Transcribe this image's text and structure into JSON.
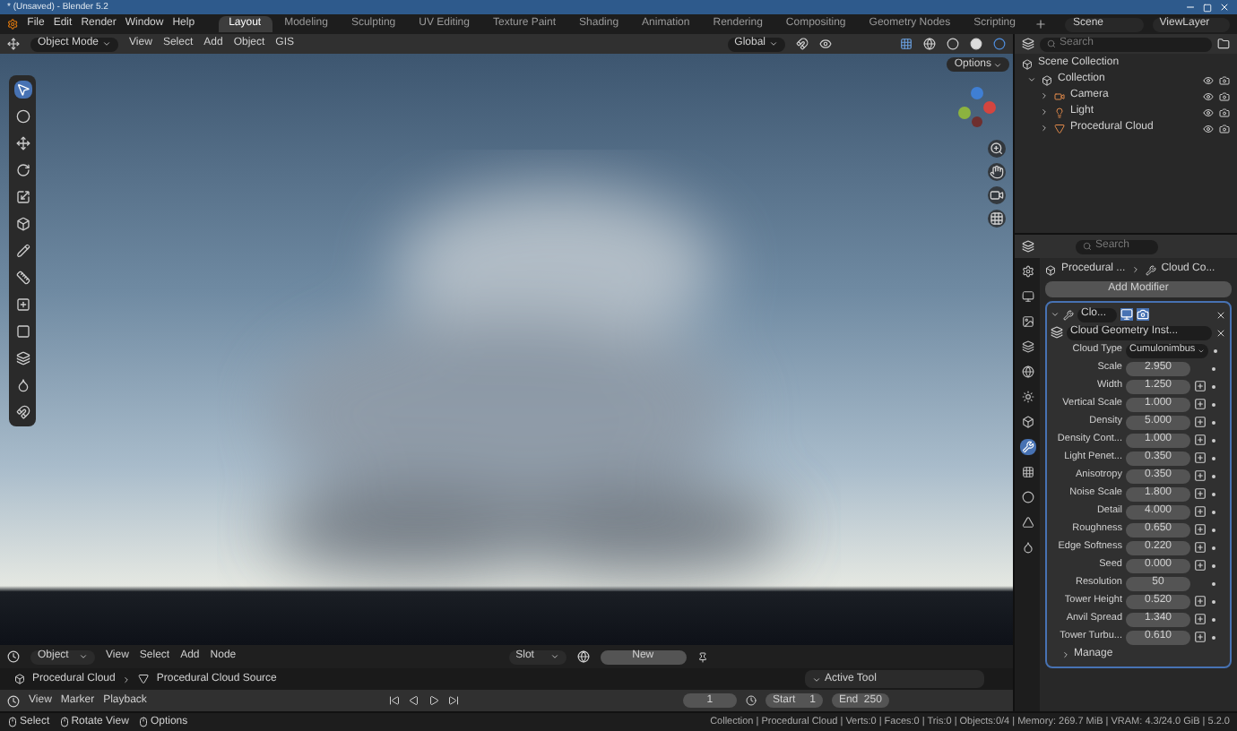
{
  "window": {
    "title": "* (Unsaved) - Blender 5.2"
  },
  "menu": [
    "File",
    "Edit",
    "Render",
    "Window",
    "Help"
  ],
  "workspaces": [
    {
      "label": "Layout",
      "selected": true
    },
    {
      "label": "Modeling",
      "selected": false
    },
    {
      "label": "Sculpting",
      "selected": false
    },
    {
      "label": "UV Editing",
      "selected": false
    },
    {
      "label": "Texture Paint",
      "selected": false
    },
    {
      "label": "Shading",
      "selected": false
    },
    {
      "label": "Animation",
      "selected": false
    },
    {
      "label": "Rendering",
      "selected": false
    },
    {
      "label": "Compositing",
      "selected": false
    },
    {
      "label": "Geometry Nodes",
      "selected": false
    },
    {
      "label": "Scripting",
      "selected": false
    }
  ],
  "scene": "Scene",
  "view_layer": "ViewLayer",
  "viewport_header": {
    "mode": "Object Mode",
    "menus": [
      "View",
      "Select",
      "Add",
      "Object",
      "GIS"
    ],
    "orientation": "Global"
  },
  "viewport": {
    "options": "Options",
    "tools": [
      {
        "selected": true
      },
      {
        "selected": false
      },
      {
        "selected": false
      },
      {
        "selected": false
      },
      {
        "selected": false
      },
      {
        "selected": false
      },
      {
        "selected": false
      },
      {
        "selected": false
      },
      {
        "selected": false
      },
      {
        "selected": false
      },
      {
        "selected": false
      },
      {
        "selected": false
      },
      {
        "selected": false
      }
    ]
  },
  "outliner": {
    "search_placeholder": "Search",
    "root": "Scene Collection",
    "collections": [
      {
        "label": "Collection",
        "expanded": true,
        "children": [
          {
            "label": "Camera",
            "kind": "camera",
            "expanded": false
          },
          {
            "label": "Light",
            "kind": "light",
            "expanded": false
          },
          {
            "label": "Procedural Cloud",
            "kind": "mesh",
            "expanded": false
          }
        ]
      }
    ]
  },
  "properties": {
    "search_placeholder": "Search",
    "tabs": [
      {
        "selected": false
      },
      {
        "selected": false
      },
      {
        "selected": false
      },
      {
        "selected": false
      },
      {
        "selected": false
      },
      {
        "selected": false
      },
      {
        "selected": false
      },
      {
        "selected": true
      },
      {
        "selected": false
      },
      {
        "selected": false
      },
      {
        "selected": false
      },
      {
        "selected": false
      }
    ],
    "breadcrumb": [
      "Procedural ...",
      "Cloud Co..."
    ],
    "add_modifier": "Add Modifier",
    "modifier": {
      "name": "Clo...",
      "expanded": true,
      "node_group": "Cloud Geometry Inst...",
      "rows": [
        {
          "label": "Cloud Type",
          "value": "Cumulonimbus",
          "kind": "dropdown"
        },
        {
          "label": "Scale",
          "value": "2.950",
          "kind": "plain"
        },
        {
          "label": "Width",
          "value": "1.250",
          "kind": "socket"
        },
        {
          "label": "Vertical Scale",
          "value": "1.000",
          "kind": "socket"
        },
        {
          "label": "Density",
          "value": "5.000",
          "kind": "socket"
        },
        {
          "label": "Density Cont...",
          "value": "1.000",
          "kind": "socket"
        },
        {
          "label": "Light Penet...",
          "value": "0.350",
          "kind": "socket"
        },
        {
          "label": "Anisotropy",
          "value": "0.350",
          "kind": "socket"
        },
        {
          "label": "Noise Scale",
          "value": "1.800",
          "kind": "socket"
        },
        {
          "label": "Detail",
          "value": "4.000",
          "kind": "socket"
        },
        {
          "label": "Roughness",
          "value": "0.650",
          "kind": "socket"
        },
        {
          "label": "Edge Softness",
          "value": "0.220",
          "kind": "socket"
        },
        {
          "label": "Seed",
          "value": "0.000",
          "kind": "socket"
        },
        {
          "label": "Resolution",
          "value": "50",
          "kind": "plain"
        },
        {
          "label": "Tower Height",
          "value": "0.520",
          "kind": "socket"
        },
        {
          "label": "Anvil Spread",
          "value": "1.340",
          "kind": "socket"
        },
        {
          "label": "Tower Turbu...",
          "value": "0.610",
          "kind": "socket"
        }
      ],
      "manage": {
        "label": "Manage",
        "expanded": false
      }
    }
  },
  "node_editor": {
    "object": "Object",
    "menus": [
      "View",
      "Select",
      "Add",
      "Node"
    ],
    "slot": "Slot",
    "new": "New",
    "breadcrumb": [
      "Procedural Cloud",
      "Procedural Cloud Source"
    ],
    "active_tool": "Active Tool"
  },
  "timeline": {
    "menus": [
      "View",
      "Marker",
      "Playback"
    ],
    "frame": "1",
    "start_label": "Start",
    "start": "1",
    "end_label": "End",
    "end": "250"
  },
  "status_bar": {
    "hints": [
      "Select",
      "Rotate View",
      "Options"
    ],
    "stats": "Collection | Procedural Cloud | Verts:0 | Faces:0 | Tris:0 | Objects:0/4 | Memory: 269.7 MiB | VRAM: 4.3/24.0 GiB | 5.2.0"
  }
}
